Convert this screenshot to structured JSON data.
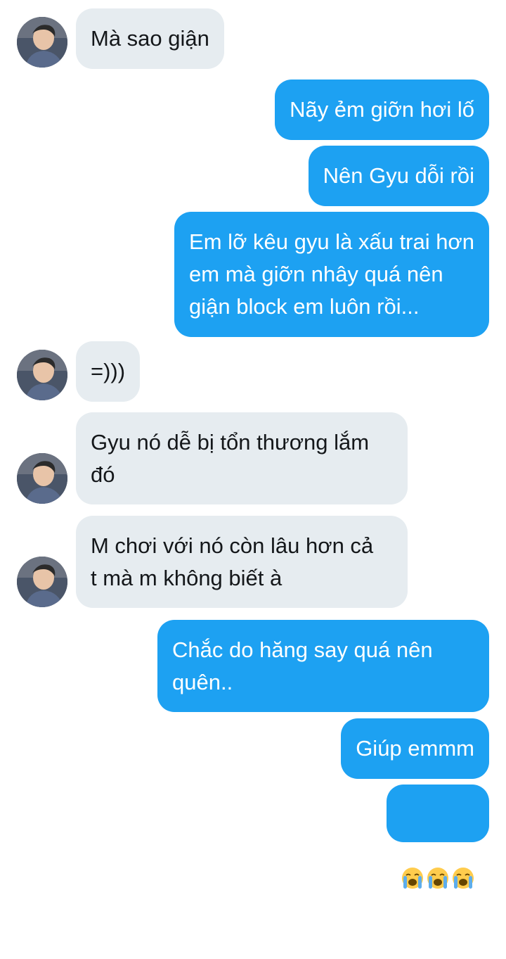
{
  "messages": [
    {
      "side": "in",
      "text": "Mà sao giận",
      "avatar": "avatar"
    },
    {
      "side": "out",
      "text": "Nãy ẻm giỡn hơi lố"
    },
    {
      "side": "out",
      "text": "Nên Gyu dỗi rồi"
    },
    {
      "side": "out",
      "text": "Em lỡ kêu gyu là xấu trai hơn\nem mà giỡn nhây quá nên\ngiận block em luôn rồi..."
    },
    {
      "side": "in",
      "text": "=)))",
      "avatar": "avatar"
    },
    {
      "side": "in",
      "text": "Gyu nó dễ bị tổn thương lắm\nđó",
      "avatar": "avatar"
    },
    {
      "side": "in",
      "text": "M chơi với nó còn lâu hơn cả\nt mà m không biết à",
      "avatar": "avatar"
    },
    {
      "side": "out",
      "text": "Chắc do hăng say quá nên\nquên.."
    },
    {
      "side": "out",
      "text": "Giúp emmm"
    },
    {
      "side": "out",
      "emojis": [
        "loudly-crying-face-icon",
        "loudly-crying-face-icon",
        "loudly-crying-face-icon"
      ]
    }
  ],
  "colors": {
    "incoming_bubble": "#e6ecf0",
    "outgoing_bubble": "#1da1f2",
    "incoming_text": "#14171a",
    "outgoing_text": "#ffffff"
  }
}
